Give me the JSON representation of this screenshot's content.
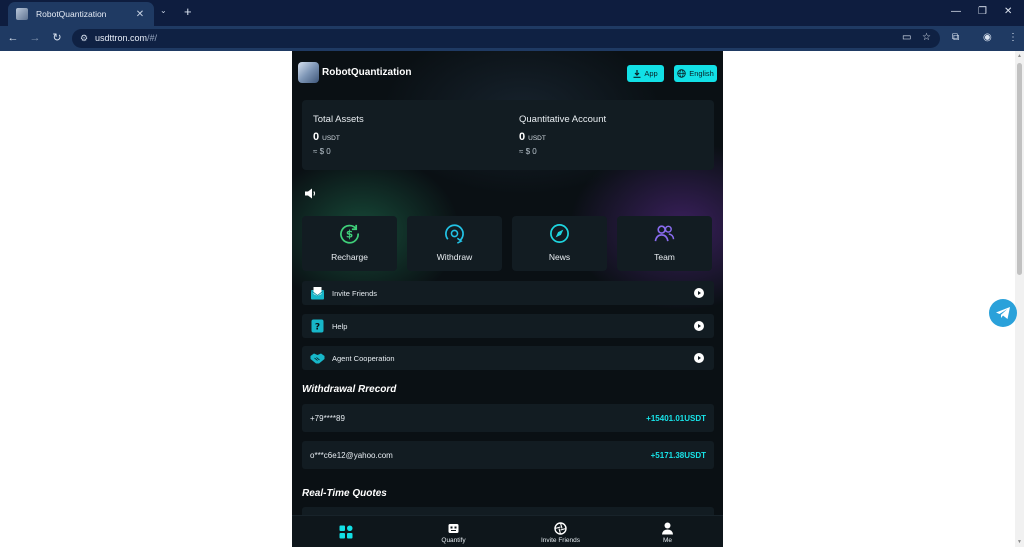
{
  "browser": {
    "tab_title": "RobotQuantization",
    "tab_close": "✕",
    "new_tab": "+",
    "url_domain": "usdttron.com",
    "url_path": "/#/"
  },
  "app": {
    "brand": "RobotQuantization",
    "app_button": "App",
    "language_button": "English"
  },
  "assets": {
    "total": {
      "label": "Total Assets",
      "value": "0",
      "unit": "USDT",
      "fiat": "≈ $ 0"
    },
    "quant": {
      "label": "Quantitative Account",
      "value": "0",
      "unit": "USDT",
      "fiat": "≈ $ 0"
    }
  },
  "quick_actions": [
    {
      "label": "Recharge",
      "icon": "dollar-circle-icon",
      "color": "#3fd07a"
    },
    {
      "label": "Withdraw",
      "icon": "coin-withdraw-icon",
      "color": "#22c3e6"
    },
    {
      "label": "News",
      "icon": "compass-icon",
      "color": "#1ed6e0"
    },
    {
      "label": "Team",
      "icon": "people-icon",
      "color": "#8a6cf0"
    }
  ],
  "menu": [
    {
      "label": "Invite Friends",
      "icon": "envelope-icon"
    },
    {
      "label": "Help",
      "icon": "question-icon"
    },
    {
      "label": "Agent Cooperation",
      "icon": "handshake-icon"
    }
  ],
  "withdrawal": {
    "title": "Withdrawal Rrecord",
    "rows": [
      {
        "user": "+79****89",
        "amount": "+15401.01USDT"
      },
      {
        "user": "o***c6e12@yahoo.com",
        "amount": "+5171.38USDT"
      }
    ]
  },
  "quotes": {
    "title": "Real-Time Quotes"
  },
  "bottom_nav": [
    {
      "label": "",
      "icon": "grid-home-icon"
    },
    {
      "label": "Quantify",
      "icon": "robot-icon"
    },
    {
      "label": "Invite Friends",
      "icon": "aperture-icon"
    },
    {
      "label": "Me",
      "icon": "person-icon"
    }
  ],
  "colors": {
    "accent": "#12e0e6",
    "card": "#121c22",
    "background": "#0a1014"
  }
}
